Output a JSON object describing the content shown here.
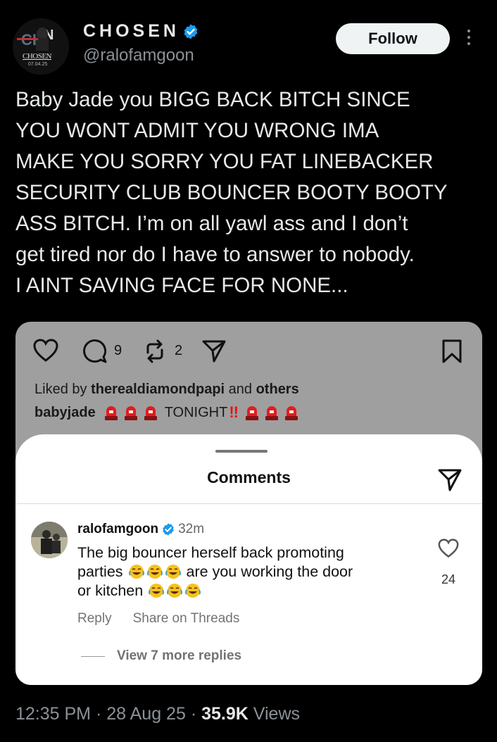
{
  "author": {
    "display_name": "CHOSEN",
    "handle": "@ralofamgoon",
    "avatar_text": "CHOSEN",
    "avatar_date": "07.04.25"
  },
  "follow_label": "Follow",
  "tweet_text": "Baby Jade you BIGG BACK BITCH SINCE\nYOU WONT ADMIT YOU WRONG IMA\nMAKE YOU SORRY YOU FAT LINEBACKER\nSECURITY CLUB BOUNCER BOOTY BOOTY\nASS BITCH. I’m on all yawl ass and I don’t\nget tired nor do I have to answer to nobody.\nI AINT SAVING FACE FOR NONE...",
  "embedded_post": {
    "comment_count": "9",
    "repost_count": "2",
    "liked_prefix": "Liked by",
    "liked_user": "therealdiamondpapi",
    "liked_and": "and",
    "liked_others": "others",
    "caption_user": "babyjade",
    "caption_text": "TONIGHT",
    "caption_bang": "!!",
    "comments_sheet": {
      "title": "Comments",
      "comment": {
        "user": "ralofamgoon",
        "time": "32m",
        "text_1": "The big bouncer herself back promoting",
        "text_2a": "parties",
        "text_2b": "are you working the door",
        "text_3": "or kitchen",
        "likes": "24",
        "reply_label": "Reply",
        "share_label": "Share on Threads"
      },
      "view_replies": "View 7 more replies"
    }
  },
  "meta": {
    "time": "12:35 PM",
    "date": "28 Aug 25",
    "views_count": "35.9K",
    "views_label": "Views"
  },
  "colors": {
    "background": "#000000",
    "verified": "#1d9bf0",
    "card_gray": "#9f9f9f",
    "siren_red": "#e11d1d"
  },
  "icons": [
    "verified-badge-icon",
    "more-icon",
    "heart-icon",
    "comment-icon",
    "repost-icon",
    "share-icon",
    "bookmark-icon",
    "siren-icon",
    "laughing-emoji-icon"
  ]
}
